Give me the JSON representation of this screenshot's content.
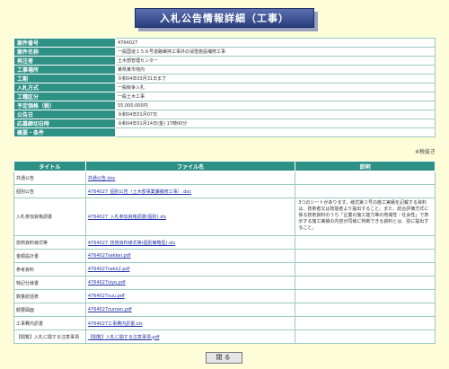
{
  "page_title": "入札公告情報詳細（工事）",
  "info": [
    {
      "label": "案件番号",
      "value": "4764027"
    },
    {
      "label": "案件名称",
      "value": "一般国道１５８号道路維持工事外の消雪施設補修工事"
    },
    {
      "label": "発注者",
      "value": "土木部管理センター"
    },
    {
      "label": "工事場所",
      "value": "某県某市地内"
    },
    {
      "label": "工期",
      "value": "令和04年03月31日まで"
    },
    {
      "label": "入札方式",
      "value": "一般競争入札"
    },
    {
      "label": "工種区分",
      "value": "一般土木工事"
    },
    {
      "label": "予定価格（税）",
      "value": "55,000,000円"
    },
    {
      "label": "公告日",
      "value": "令和04年01月07日"
    },
    {
      "label": "応募締切日時",
      "value": "令和04年01月14日(金) 17時00分"
    },
    {
      "label": "概要・条件",
      "value": ""
    }
  ],
  "tax_note": "※税抜き",
  "files_table": {
    "headers": [
      "タイトル",
      "ファイル名",
      "説明"
    ],
    "rows": [
      {
        "title": "共通公告",
        "file": "共通公告.doc",
        "desc": ""
      },
      {
        "title": "個別公告",
        "file": "4764027_個別公告（土木部事業課補修工事）.doc",
        "desc": ""
      },
      {
        "title": "入札参加資格調書",
        "file": "4764027_入札参加資格調書(個別).xls",
        "desc": "3つのシートがあります。様式第３号の施工実績を記載する資料は、技術者又は技能者より提出すること。また、総合評価方式に係る技術資料のうち「企業の施工能力等の地域性・社会性」で表示する施工実績の内容が同様に判断できる資料とは、別に提出すること。"
      },
      {
        "title": "技術資料様式等",
        "file": "4764027_技術資料様式等(個別簡略型).xls",
        "desc": ""
      },
      {
        "title": "金額設計書",
        "file": "4764027sekkei.pdf",
        "desc": ""
      },
      {
        "title": "参考資料",
        "file": "4764027sekk2.pdf",
        "desc": ""
      },
      {
        "title": "特記仕様書",
        "file": "4764027siyo.pdf",
        "desc": ""
      },
      {
        "title": "数量総括表",
        "file": "4764027suu.pdf",
        "desc": ""
      },
      {
        "title": "概要図面",
        "file": "4764027zumen.pdf",
        "desc": ""
      },
      {
        "title": "工事費内訳書",
        "file": "4764027工事費内訳書.xls",
        "desc": ""
      },
      {
        "title": "【閲覧】入札に関する注意事項",
        "file": "【閲覧】入札に関する注意事項.pdf",
        "desc": ""
      }
    ]
  },
  "close_button": "閉る"
}
